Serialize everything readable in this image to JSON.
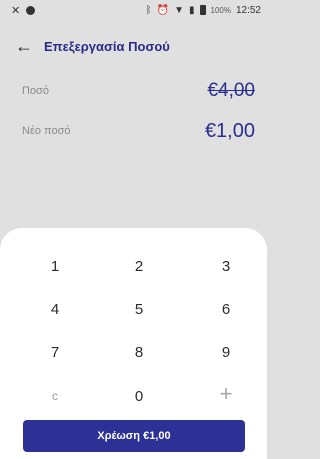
{
  "status_bar": {
    "left_icon": "close-x-icon",
    "notification_icon": "dot-icon",
    "bluetooth_icon": "bluetooth-icon",
    "alarm_icon": "alarm-icon",
    "wifi_icon": "wifi-icon",
    "sim_icon": "sim-icon",
    "battery_percent": "100%",
    "time": "12:52"
  },
  "app_bar": {
    "back_icon": "arrow-left-icon",
    "title": "Επεξεργασία Ποσού"
  },
  "amounts": {
    "amount_label": "Ποσό",
    "amount_value": "€4,00",
    "new_amount_label": "Νέο ποσό",
    "new_amount_value": "€1,00"
  },
  "keypad": {
    "keys": [
      "1",
      "2",
      "3",
      "4",
      "5",
      "6",
      "7",
      "8",
      "9",
      "c",
      "0",
      "+"
    ]
  },
  "charge_button": {
    "label": "Χρέωση €1,00"
  },
  "colors": {
    "accent": "#2d3196",
    "background": "#e0e0e0",
    "sheet": "#ffffff"
  }
}
